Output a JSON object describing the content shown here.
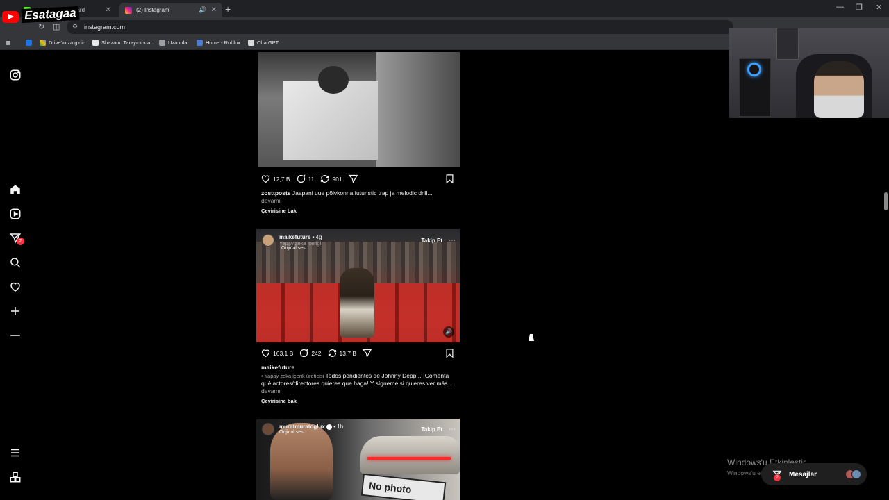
{
  "browser": {
    "tabs": [
      {
        "title": "Stream · Dashboard"
      },
      {
        "title": "(2) Instagram"
      }
    ],
    "url": "instagram.com",
    "bookmarks": [
      {
        "label": "Drive'ınıza gidin"
      },
      {
        "label": "Shazam: Tarayıcında..."
      },
      {
        "label": "Uzantılar"
      },
      {
        "label": "Home - Roblox"
      },
      {
        "label": "ChatGPT"
      }
    ]
  },
  "overlay": {
    "channel_name": "Esatagaa"
  },
  "sidebar": {
    "notification_count": "2"
  },
  "posts": [
    {
      "likes": "12,7 B",
      "comments": "11",
      "reposts": "901",
      "username": "zosttposts",
      "caption": "Jaapani uue põlvkonna futuristic trap ja melodic drill...",
      "more": "devamı",
      "translate": "Çevirisine bak"
    },
    {
      "username": "maikefuture",
      "time": "• 4g",
      "ai_label": "Yapay zeka içeriği",
      "audio": "Orijinal ses",
      "follow": "Takip Et",
      "likes": "163,1 B",
      "comments": "242",
      "reposts": "13,7 B",
      "caption_user": "maikefuture",
      "ai_creator": "• Yapay zeka içerik üreticisi",
      "caption": "Todos pendientes de Johnny Depp... ¡Comenta qué actores/directores quieres que haga! Y sígueme si quieres ver más...",
      "more": "devamı",
      "translate": "Çevirisine bak"
    },
    {
      "username": "muratmuratoglux",
      "time": "• 1h",
      "audio": "Orijinal ses",
      "follow": "Takip Et",
      "sign_text": "No photo"
    }
  ],
  "windows": {
    "activate_title": "Windows'u Etkinleştir",
    "activate_sub": "Windows'u etkinleştirmek için Ayarlar'a gidin."
  },
  "messages": {
    "label": "Mesajlar",
    "count": "2"
  }
}
